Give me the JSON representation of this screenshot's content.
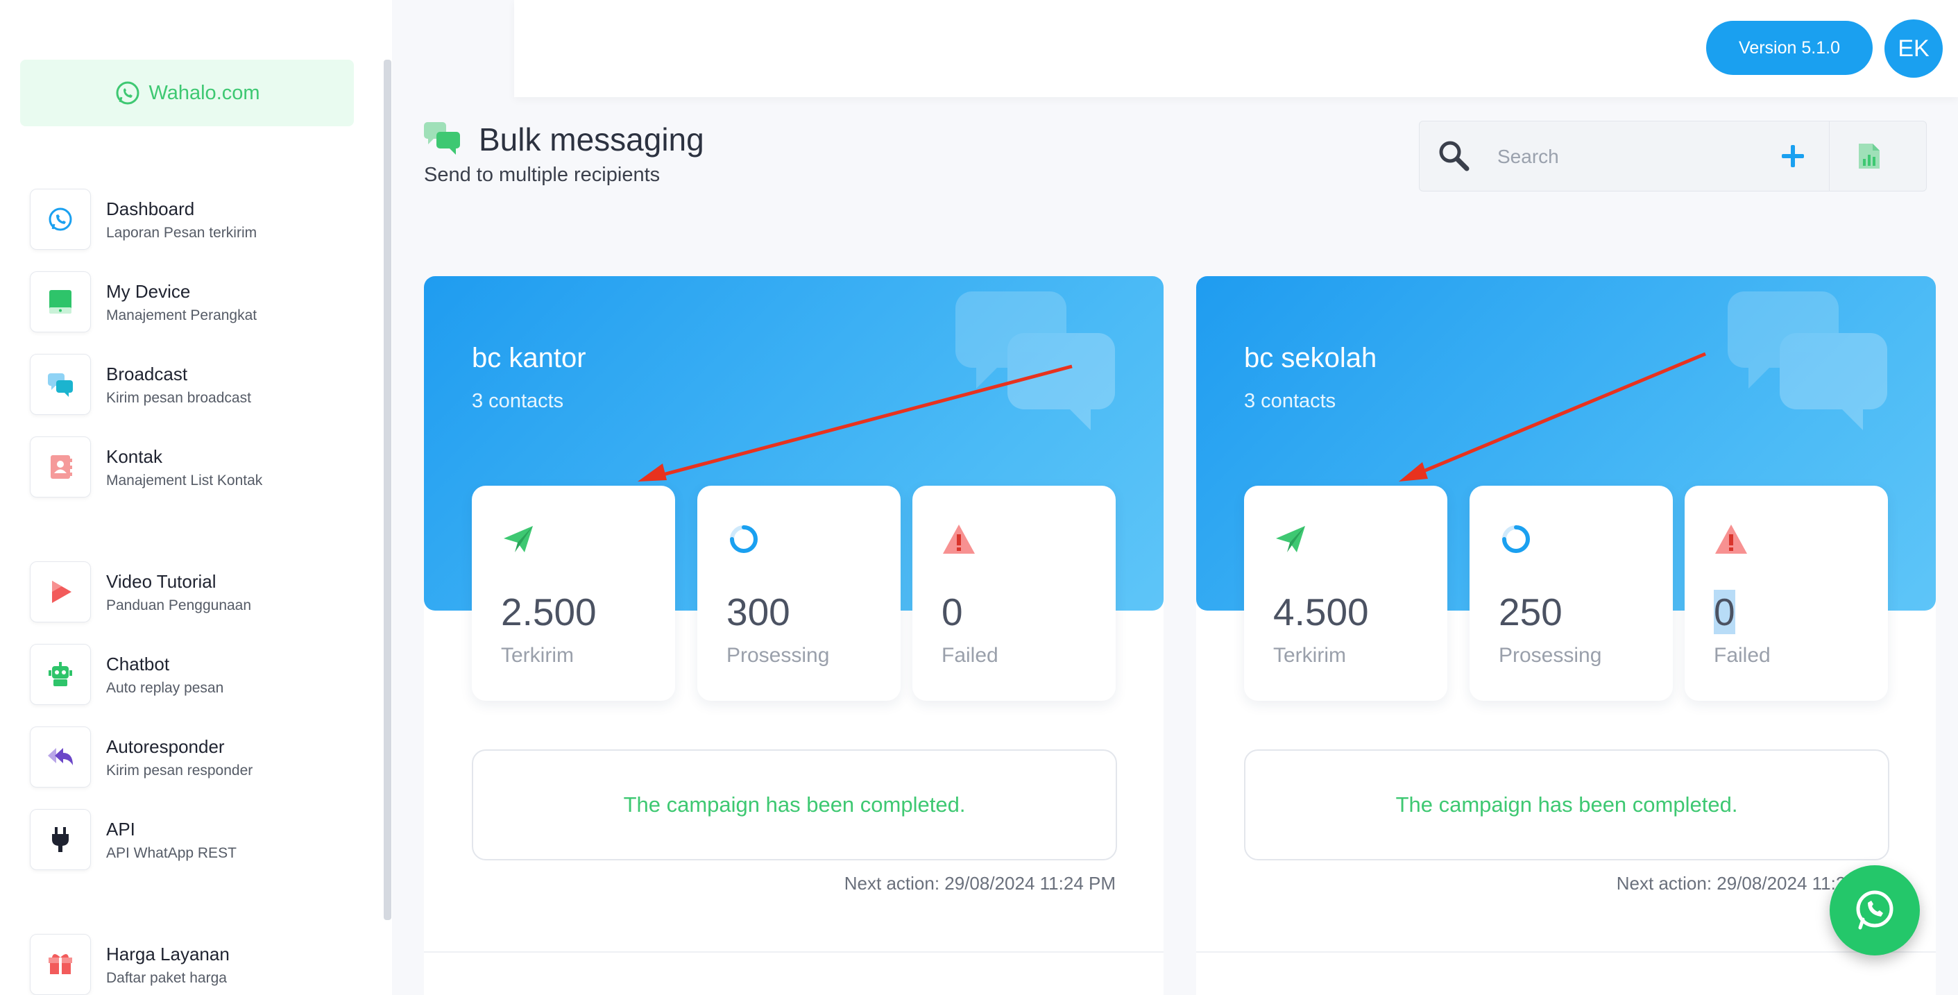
{
  "brand": {
    "label": "Wahalo.com"
  },
  "sidebar": {
    "items": [
      {
        "title": "Dashboard",
        "subtitle": "Laporan Pesan terkirim",
        "icon": "whatsapp-icon"
      },
      {
        "title": "My Device",
        "subtitle": "Manajement Perangkat",
        "icon": "tablet-icon"
      },
      {
        "title": "Broadcast",
        "subtitle": "Kirim pesan broadcast",
        "icon": "chat-bubbles-icon"
      },
      {
        "title": "Kontak",
        "subtitle": "Manajement List Kontak",
        "icon": "contact-book-icon"
      },
      {
        "title": "Video Tutorial",
        "subtitle": "Panduan Penggunaan",
        "icon": "play-icon"
      },
      {
        "title": "Chatbot",
        "subtitle": "Auto replay pesan",
        "icon": "robot-icon"
      },
      {
        "title": "Autoresponder",
        "subtitle": "Kirim pesan responder",
        "icon": "reply-icon"
      },
      {
        "title": "API",
        "subtitle": "API WhatApp REST",
        "icon": "plug-icon"
      },
      {
        "title": "Harga Layanan",
        "subtitle": "Daftar paket harga",
        "icon": "gift-box-icon"
      }
    ]
  },
  "header": {
    "version_label": "Version 5.1.0",
    "avatar_initials": "EK"
  },
  "page": {
    "title": "Bulk messaging",
    "subtitle": "Send to multiple recipients"
  },
  "search": {
    "placeholder": "Search"
  },
  "campaigns": [
    {
      "name": "bc kantor",
      "contacts": "3 contacts",
      "stats": [
        {
          "value": "2.500",
          "label": "Terkirim",
          "icon": "send-icon"
        },
        {
          "value": "300",
          "label": "Prosessing",
          "icon": "spinner-icon"
        },
        {
          "value": "0",
          "label": "Failed",
          "icon": "warning-icon"
        }
      ],
      "status": "The campaign has been completed.",
      "next_action": "Next action: 29/08/2024 11:24 PM"
    },
    {
      "name": "bc sekolah",
      "contacts": "3 contacts",
      "stats": [
        {
          "value": "4.500",
          "label": "Terkirim",
          "icon": "send-icon"
        },
        {
          "value": "250",
          "label": "Prosessing",
          "icon": "spinner-icon"
        },
        {
          "value": "0",
          "label": "Failed",
          "icon": "warning-icon"
        }
      ],
      "status": "The campaign has been completed.",
      "next_action": "Next action: 29/08/2024 11:24 PM"
    }
  ],
  "colors": {
    "accent": "#1aa0f0",
    "success": "#3ec872",
    "annotation_arrow": "#e8321e"
  }
}
